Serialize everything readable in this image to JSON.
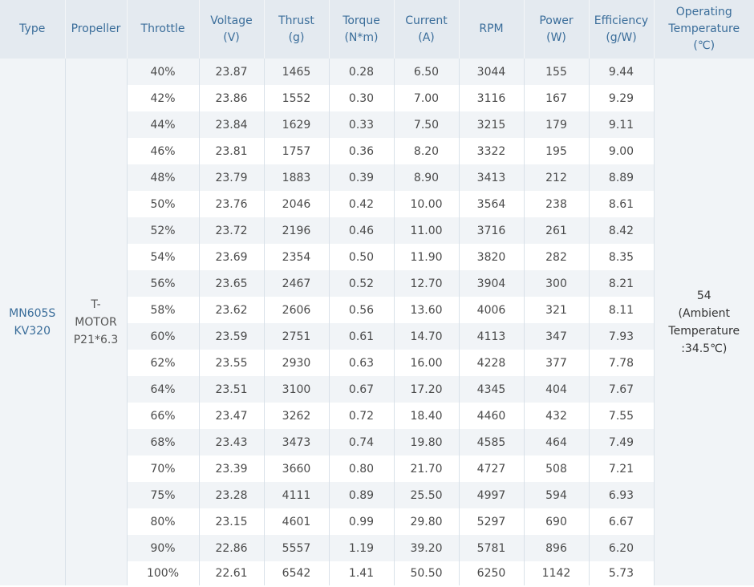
{
  "headers": {
    "type": [
      "Type"
    ],
    "propeller": [
      "Propeller"
    ],
    "throttle": [
      "Throttle"
    ],
    "voltage": [
      "Voltage",
      "(V)"
    ],
    "thrust": [
      "Thrust",
      "(g)"
    ],
    "torque": [
      "Torque",
      "(N*m)"
    ],
    "current": [
      "Current",
      "(A)"
    ],
    "rpm": [
      "RPM"
    ],
    "power": [
      "Power",
      "(W)"
    ],
    "efficiency": [
      "Efficiency",
      "(g/W)"
    ],
    "operating_temp": [
      "Operating",
      "Temperature",
      "(℃)"
    ]
  },
  "merged": {
    "type": [
      "MN605S",
      "KV320"
    ],
    "propeller": [
      "T-",
      "MOTOR",
      "P21*6.3"
    ],
    "operating_temp": [
      "54",
      "(Ambient",
      "Temperature",
      ":34.5℃)"
    ]
  },
  "rows": [
    {
      "throttle": "40%",
      "voltage": "23.87",
      "thrust": "1465",
      "torque": "0.28",
      "current": "6.50",
      "rpm": "3044",
      "power": "155",
      "efficiency": "9.44"
    },
    {
      "throttle": "42%",
      "voltage": "23.86",
      "thrust": "1552",
      "torque": "0.30",
      "current": "7.00",
      "rpm": "3116",
      "power": "167",
      "efficiency": "9.29"
    },
    {
      "throttle": "44%",
      "voltage": "23.84",
      "thrust": "1629",
      "torque": "0.33",
      "current": "7.50",
      "rpm": "3215",
      "power": "179",
      "efficiency": "9.11"
    },
    {
      "throttle": "46%",
      "voltage": "23.81",
      "thrust": "1757",
      "torque": "0.36",
      "current": "8.20",
      "rpm": "3322",
      "power": "195",
      "efficiency": "9.00"
    },
    {
      "throttle": "48%",
      "voltage": "23.79",
      "thrust": "1883",
      "torque": "0.39",
      "current": "8.90",
      "rpm": "3413",
      "power": "212",
      "efficiency": "8.89"
    },
    {
      "throttle": "50%",
      "voltage": "23.76",
      "thrust": "2046",
      "torque": "0.42",
      "current": "10.00",
      "rpm": "3564",
      "power": "238",
      "efficiency": "8.61"
    },
    {
      "throttle": "52%",
      "voltage": "23.72",
      "thrust": "2196",
      "torque": "0.46",
      "current": "11.00",
      "rpm": "3716",
      "power": "261",
      "efficiency": "8.42"
    },
    {
      "throttle": "54%",
      "voltage": "23.69",
      "thrust": "2354",
      "torque": "0.50",
      "current": "11.90",
      "rpm": "3820",
      "power": "282",
      "efficiency": "8.35"
    },
    {
      "throttle": "56%",
      "voltage": "23.65",
      "thrust": "2467",
      "torque": "0.52",
      "current": "12.70",
      "rpm": "3904",
      "power": "300",
      "efficiency": "8.21"
    },
    {
      "throttle": "58%",
      "voltage": "23.62",
      "thrust": "2606",
      "torque": "0.56",
      "current": "13.60",
      "rpm": "4006",
      "power": "321",
      "efficiency": "8.11"
    },
    {
      "throttle": "60%",
      "voltage": "23.59",
      "thrust": "2751",
      "torque": "0.61",
      "current": "14.70",
      "rpm": "4113",
      "power": "347",
      "efficiency": "7.93"
    },
    {
      "throttle": "62%",
      "voltage": "23.55",
      "thrust": "2930",
      "torque": "0.63",
      "current": "16.00",
      "rpm": "4228",
      "power": "377",
      "efficiency": "7.78"
    },
    {
      "throttle": "64%",
      "voltage": "23.51",
      "thrust": "3100",
      "torque": "0.67",
      "current": "17.20",
      "rpm": "4345",
      "power": "404",
      "efficiency": "7.67"
    },
    {
      "throttle": "66%",
      "voltage": "23.47",
      "thrust": "3262",
      "torque": "0.72",
      "current": "18.40",
      "rpm": "4460",
      "power": "432",
      "efficiency": "7.55"
    },
    {
      "throttle": "68%",
      "voltage": "23.43",
      "thrust": "3473",
      "torque": "0.74",
      "current": "19.80",
      "rpm": "4585",
      "power": "464",
      "efficiency": "7.49"
    },
    {
      "throttle": "70%",
      "voltage": "23.39",
      "thrust": "3660",
      "torque": "0.80",
      "current": "21.70",
      "rpm": "4727",
      "power": "508",
      "efficiency": "7.21"
    },
    {
      "throttle": "75%",
      "voltage": "23.28",
      "thrust": "4111",
      "torque": "0.89",
      "current": "25.50",
      "rpm": "4997",
      "power": "594",
      "efficiency": "6.93"
    },
    {
      "throttle": "80%",
      "voltage": "23.15",
      "thrust": "4601",
      "torque": "0.99",
      "current": "29.80",
      "rpm": "5297",
      "power": "690",
      "efficiency": "6.67"
    },
    {
      "throttle": "90%",
      "voltage": "22.86",
      "thrust": "5557",
      "torque": "1.19",
      "current": "39.20",
      "rpm": "5781",
      "power": "896",
      "efficiency": "6.20"
    },
    {
      "throttle": "100%",
      "voltage": "22.61",
      "thrust": "6542",
      "torque": "1.41",
      "current": "50.50",
      "rpm": "6250",
      "power": "1142",
      "efficiency": "5.73"
    }
  ]
}
